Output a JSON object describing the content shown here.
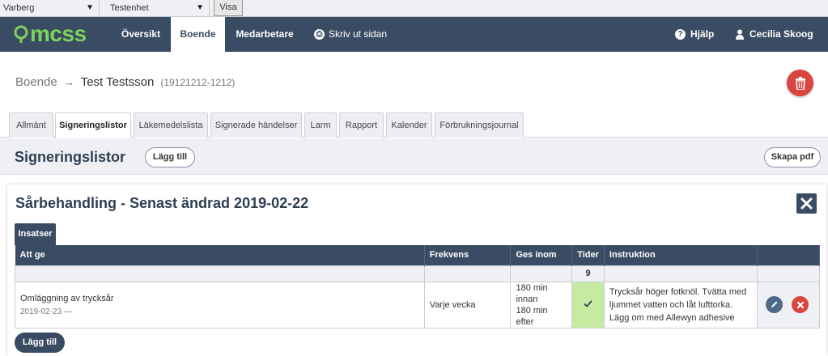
{
  "selectors": {
    "region": "Varberg",
    "unit": "Testenhet",
    "show_label": "Visa"
  },
  "nav": {
    "logo": "mcss",
    "items": [
      "Översikt",
      "Boende",
      "Medarbetare"
    ],
    "print_label": "Skriv ut sidan",
    "help_label": "Hjälp",
    "user_name": "Cecilia Skoog"
  },
  "breadcrumb": {
    "parent": "Boende",
    "name": "Test Testsson",
    "personal_number": "(19121212-1212)"
  },
  "tabs": [
    "Allmänt",
    "Signeringslistor",
    "Läkemedelslista",
    "Signerade händelser",
    "Larm",
    "Rapport",
    "Kalender",
    "Förbrukningsjournal"
  ],
  "section": {
    "title": "Signeringslistor",
    "add_label": "Lägg till",
    "pdf_label": "Skapa pdf"
  },
  "card": {
    "title": "Sårbehandling - Senast ändrad 2019-02-22",
    "subtab": "Insatser",
    "columns": [
      "Att ge",
      "Frekvens",
      "Ges inom",
      "Tider",
      "Instruktion"
    ],
    "times_header_value": "9",
    "rows": [
      {
        "name": "Omläggning av trycksår",
        "date": "2019-02-23 —",
        "frequency": "Varje vecka",
        "window": [
          "180 min",
          "innan",
          "180 min efter"
        ],
        "instruction": "Trycksår höger fotknöl. Tvätta med ljummet vatten och låt lufttorka. Lägg om med Allewyn adhesive"
      }
    ],
    "add_label": "Lägg till"
  },
  "colors": {
    "navy": "#3a4c63",
    "accent_green": "#7dd35a",
    "danger": "#d9453f",
    "check_bg": "#c7eaa3"
  }
}
